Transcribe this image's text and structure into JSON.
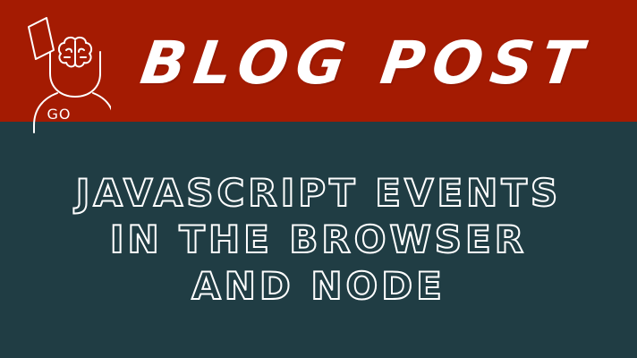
{
  "header": {
    "label": "BLOG POST",
    "logo_icon": "head-brain-icon",
    "logo_text": "GO"
  },
  "title": {
    "lines": [
      "JAVASCRIPT EVENTS",
      "IN THE BROWSER",
      "AND NODE"
    ]
  },
  "colors": {
    "header_background": "#a41b02",
    "body_background": "#203d44",
    "text": "#ffffff"
  }
}
